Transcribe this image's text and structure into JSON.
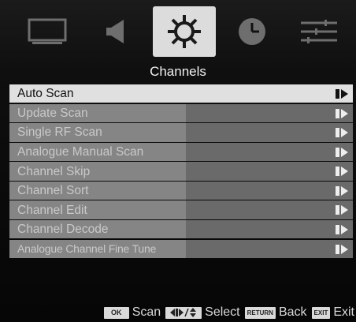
{
  "tabs": [
    {
      "icon": "picture-icon",
      "active": false
    },
    {
      "icon": "speaker-icon",
      "active": false
    },
    {
      "icon": "gear-icon",
      "active": true
    },
    {
      "icon": "clock-icon",
      "active": false
    },
    {
      "icon": "sliders-icon",
      "active": false
    }
  ],
  "menu": {
    "title": "Channels",
    "items": [
      {
        "label": "Auto Scan",
        "selected": true
      },
      {
        "label": "Update Scan",
        "selected": false
      },
      {
        "label": "Single RF Scan",
        "selected": false
      },
      {
        "label": "Analogue Manual Scan",
        "selected": false
      },
      {
        "label": "Channel Skip",
        "selected": false
      },
      {
        "label": "Channel Sort",
        "selected": false
      },
      {
        "label": "Channel Edit",
        "selected": false
      },
      {
        "label": "Channel Decode",
        "selected": false
      },
      {
        "label": "Analogue Channel Fine Tune",
        "selected": false
      }
    ]
  },
  "footer": {
    "ok_key": "OK",
    "ok_label": "Scan",
    "select_label": "Select",
    "return_key": "RETURN",
    "return_label": "Back",
    "exit_key": "EXIT",
    "exit_label": "Exit"
  },
  "colors": {
    "selected_row": "#e0e0e0",
    "row_left": "#858585",
    "row_right": "#6a6a6a",
    "active_tab": "#dcdcdc"
  }
}
